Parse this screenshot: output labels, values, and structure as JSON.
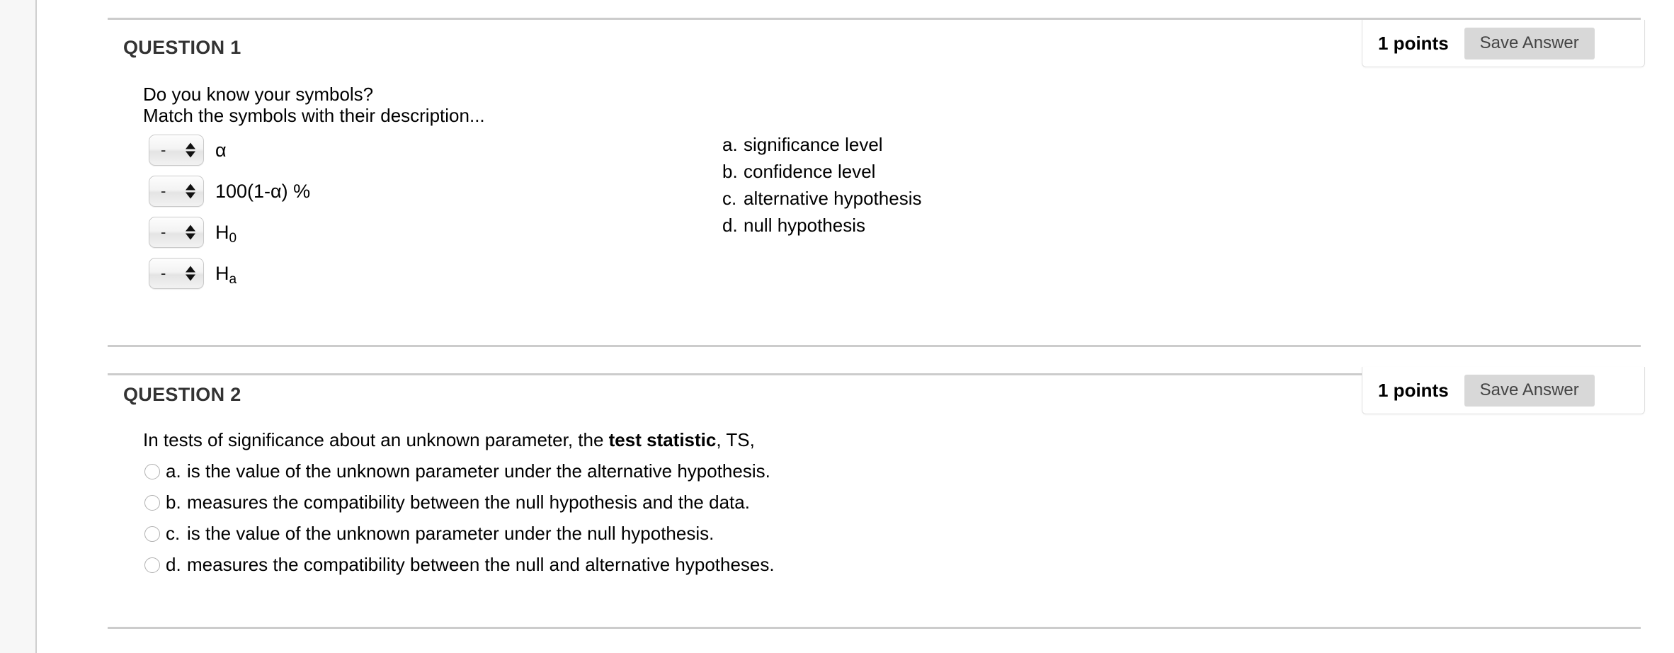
{
  "questions": [
    {
      "header": "QUESTION 1",
      "points_label": "1 points",
      "save_label": "Save Answer",
      "prompt_line1": "Do you know your symbols?",
      "prompt_line2": "Match the symbols with their description...",
      "match_items": [
        {
          "selected": "-",
          "symbol": "α",
          "symbol_sub": ""
        },
        {
          "selected": "-",
          "symbol": "100(1-α) %",
          "symbol_sub": ""
        },
        {
          "selected": "-",
          "symbol": "H",
          "symbol_sub": "0"
        },
        {
          "selected": "-",
          "symbol": "H",
          "symbol_sub": "a"
        }
      ],
      "match_options": [
        {
          "letter": "a.",
          "text": "significance level"
        },
        {
          "letter": "b.",
          "text": "confidence level"
        },
        {
          "letter": "c.",
          "text": "alternative hypothesis"
        },
        {
          "letter": "d.",
          "text": "null hypothesis"
        }
      ]
    },
    {
      "header": "QUESTION 2",
      "points_label": "1 points",
      "save_label": "Save Answer",
      "prompt_pre": "In tests of significance about an unknown parameter, the ",
      "prompt_bold": "test statistic",
      "prompt_post": ", TS,",
      "choices": [
        {
          "letter": "a.",
          "text": "is the value of the unknown parameter under the alternative hypothesis."
        },
        {
          "letter": "b.",
          "text": "measures the compatibility between the null hypothesis and the data."
        },
        {
          "letter": "c.",
          "text": "is the value of the unknown parameter under the null hypothesis."
        },
        {
          "letter": "d.",
          "text": "measures the compatibility between the null and alternative hypotheses."
        }
      ]
    }
  ],
  "colors": {
    "page_background": "#f7f7f7",
    "content_background": "#ffffff",
    "rule": "#cccccc",
    "heading_text": "#333333",
    "button_background": "#d8d8d8",
    "button_text": "#444444"
  }
}
